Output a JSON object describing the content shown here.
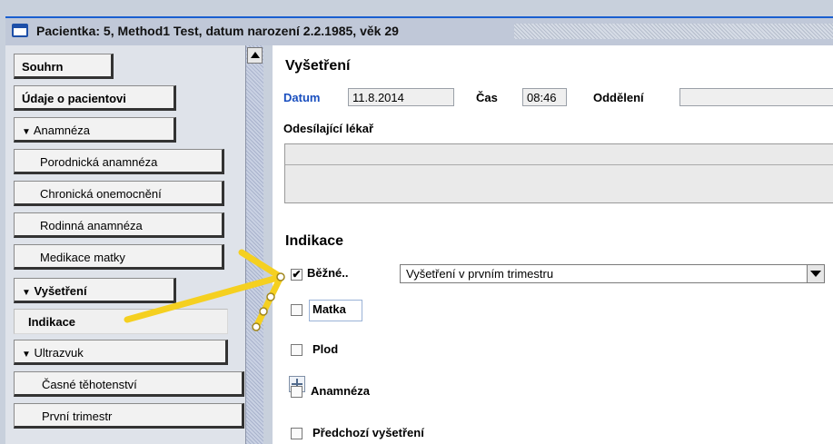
{
  "window": {
    "title": "Pacientka: 5, Method1 Test, datum narození 2.2.1985, věk 29"
  },
  "nav": {
    "items": [
      {
        "label": "Souhrn"
      },
      {
        "label": "Údaje o pacientovi"
      },
      {
        "label": "Anamnéza"
      },
      {
        "label": "Porodnická anamnéza"
      },
      {
        "label": "Chronická onemocnění"
      },
      {
        "label": "Rodinná anamnéza"
      },
      {
        "label": "Medikace matky"
      },
      {
        "label": "Vyšetření"
      },
      {
        "label": "Indikace"
      },
      {
        "label": "Ultrazvuk"
      },
      {
        "label": "Časné těhotenství"
      },
      {
        "label": "První trimestr"
      }
    ]
  },
  "exam": {
    "heading": "Vyšetření",
    "datum_label": "Datum",
    "datum_value": "11.8.2014",
    "cas_label": "Čas",
    "cas_value": "08:46",
    "oddeleni_label": "Oddělení",
    "odesilajici_label": "Odesílající lékař"
  },
  "indikace": {
    "heading": "Indikace",
    "items": [
      {
        "label": "Běžné..",
        "checked": true
      },
      {
        "label": "Matka",
        "checked": false
      },
      {
        "label": "Plod",
        "checked": false
      },
      {
        "label": "Anamnéza",
        "checked": false
      },
      {
        "label": "Předchozí vyšetření",
        "checked": false
      }
    ],
    "dropdown_value": "Vyšetření v prvním trimestru"
  },
  "colors": {
    "accent_blue": "#1a5fd0",
    "annotation_yellow": "#f5d020"
  }
}
